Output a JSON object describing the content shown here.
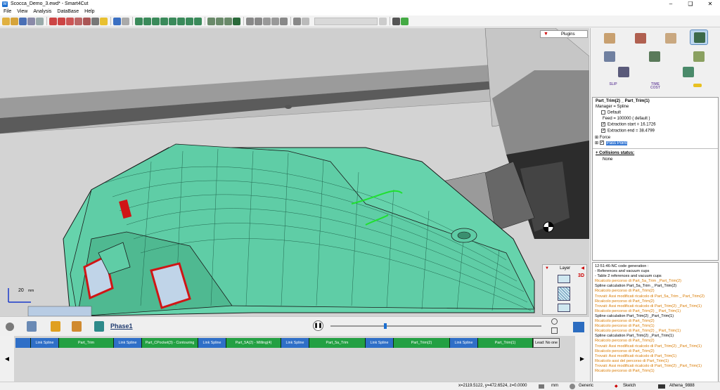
{
  "window": {
    "title": "Scocca_Demo_3.ewd* - Smart4Cut"
  },
  "menu": {
    "items": [
      "File",
      "View",
      "Analysis",
      "DataBase",
      "Help"
    ]
  },
  "viewport": {
    "plugins_label": "Plugins",
    "axis_value": "20",
    "axis_unit": "mm",
    "layer": {
      "title": "Layer",
      "badge": "3D"
    }
  },
  "right_panel": {
    "icon_texts": [
      "SLIP",
      "TIME\nCOST"
    ],
    "properties": {
      "header": "Part_Trim(2) _ Part_Trim(1)",
      "manager": "Manager = Spline",
      "default_label": "Default",
      "feed": "Feed = 100000 ( default )",
      "extraction_start": "Extraction start = 16.1726",
      "extraction_end": "Extraction end = 38.4799",
      "force": "Force",
      "pass_point": "Pass Point",
      "collisions_label": "+ Collisions status:",
      "collisions_value": "None"
    },
    "log": [
      {
        "text": "12:51:46-NC code generation :",
        "color": "#000000"
      },
      {
        "text": " - References and vacuum cups",
        "color": "#000000"
      },
      {
        "text": " - Table 2 references and vacuum cups",
        "color": "#000000"
      },
      {
        "text": "Ricalcolo percorso di Part_5a_Trim _Part_Trim(2)",
        "color": "#d97a00"
      },
      {
        "text": "Spline calculation Part_5a_Trim _ Part_Trim(2)",
        "color": "#000000"
      },
      {
        "text": "Ricalcolo percorso di Part_Trim(2)",
        "color": "#d97a00"
      },
      {
        "text": "Trovati: Assi modificati ricalcolo di Part_5a_Trim _ Part_Trim(2)",
        "color": "#d97a00"
      },
      {
        "text": "Ricalcolo percorso di Part_Trim(2)",
        "color": "#d97a00"
      },
      {
        "text": "Trovati: Assi modificati ricalcolo di Part_Trim(2) _Part_Trim(1)",
        "color": "#d97a00"
      },
      {
        "text": "Ricalcolo percorso di Part_Trim(2) _ Part_Trim(1)",
        "color": "#d97a00"
      },
      {
        "text": "Spline calculation Part_Trim(2) _Part_Trim(1)",
        "color": "#000000"
      },
      {
        "text": "Ricalcolo percorso di Part_Trim(2)",
        "color": "#d97a00"
      },
      {
        "text": "Ricalcolo percorso di Part_Trim(1)",
        "color": "#d97a00"
      },
      {
        "text": "Ricalcolo percorso di Part_Trim(2) _ Part_Trim(1)",
        "color": "#d97a00"
      },
      {
        "text": "Spline calculation Part_Trim(2) _Part_Trim(1)",
        "color": "#000000"
      },
      {
        "text": "Ricalcolo percorso di Part_Trim(2)",
        "color": "#d97a00"
      },
      {
        "text": "Trovati: Assi modificati ricalcolo di Part_Trim(2) _Part_Trim(1)",
        "color": "#d97a00"
      },
      {
        "text": "Ricalcolo percorso di Part_Trim(2)",
        "color": "#d97a00"
      },
      {
        "text": "Trovati: Assi modificati ricalcolo di Part_Trim(1)",
        "color": "#d97a00"
      },
      {
        "text": "Ricalcolo assi del percorso di Part_Trim(1)",
        "color": "#d97a00"
      },
      {
        "text": "Trovati: Assi modificati ricalcolo di Part_Trim(2) _Part_Trim(1)",
        "color": "#d97a00"
      },
      {
        "text": "Ricalcolo percorso di Part_Trim(1)",
        "color": "#d97a00"
      }
    ]
  },
  "phase": {
    "title": "Phase1",
    "progress": 0.26
  },
  "timeline": {
    "segments": [
      {
        "label": "",
        "kind": "link"
      },
      {
        "label": "Link  Spline",
        "kind": "link"
      },
      {
        "label": "Part_Trim",
        "kind": "part"
      },
      {
        "label": "Link  Spline",
        "kind": "link"
      },
      {
        "label": "Part_CPocket(3) - Contouring",
        "kind": "part"
      },
      {
        "label": "Link  Spline",
        "kind": "link"
      },
      {
        "label": "Part_5A(2) - Milling(4)",
        "kind": "part"
      },
      {
        "label": "Link  Spline",
        "kind": "link"
      },
      {
        "label": "Part_5a_Trim",
        "kind": "part"
      },
      {
        "label": "Link  Spline",
        "kind": "link"
      },
      {
        "label": "Part_Trim(2)",
        "kind": "part"
      },
      {
        "label": "Link  Spline",
        "kind": "link"
      },
      {
        "label": "Part_Trim(1)",
        "kind": "part"
      },
      {
        "label": "Lead: No one",
        "kind": "lead"
      }
    ]
  },
  "status": {
    "coords": "x=2119.5122, y=472.6524, z=0.0000",
    "unit": "mm",
    "mode": "Generic",
    "sketch": "Sketch",
    "machine": "Athena_9888"
  }
}
